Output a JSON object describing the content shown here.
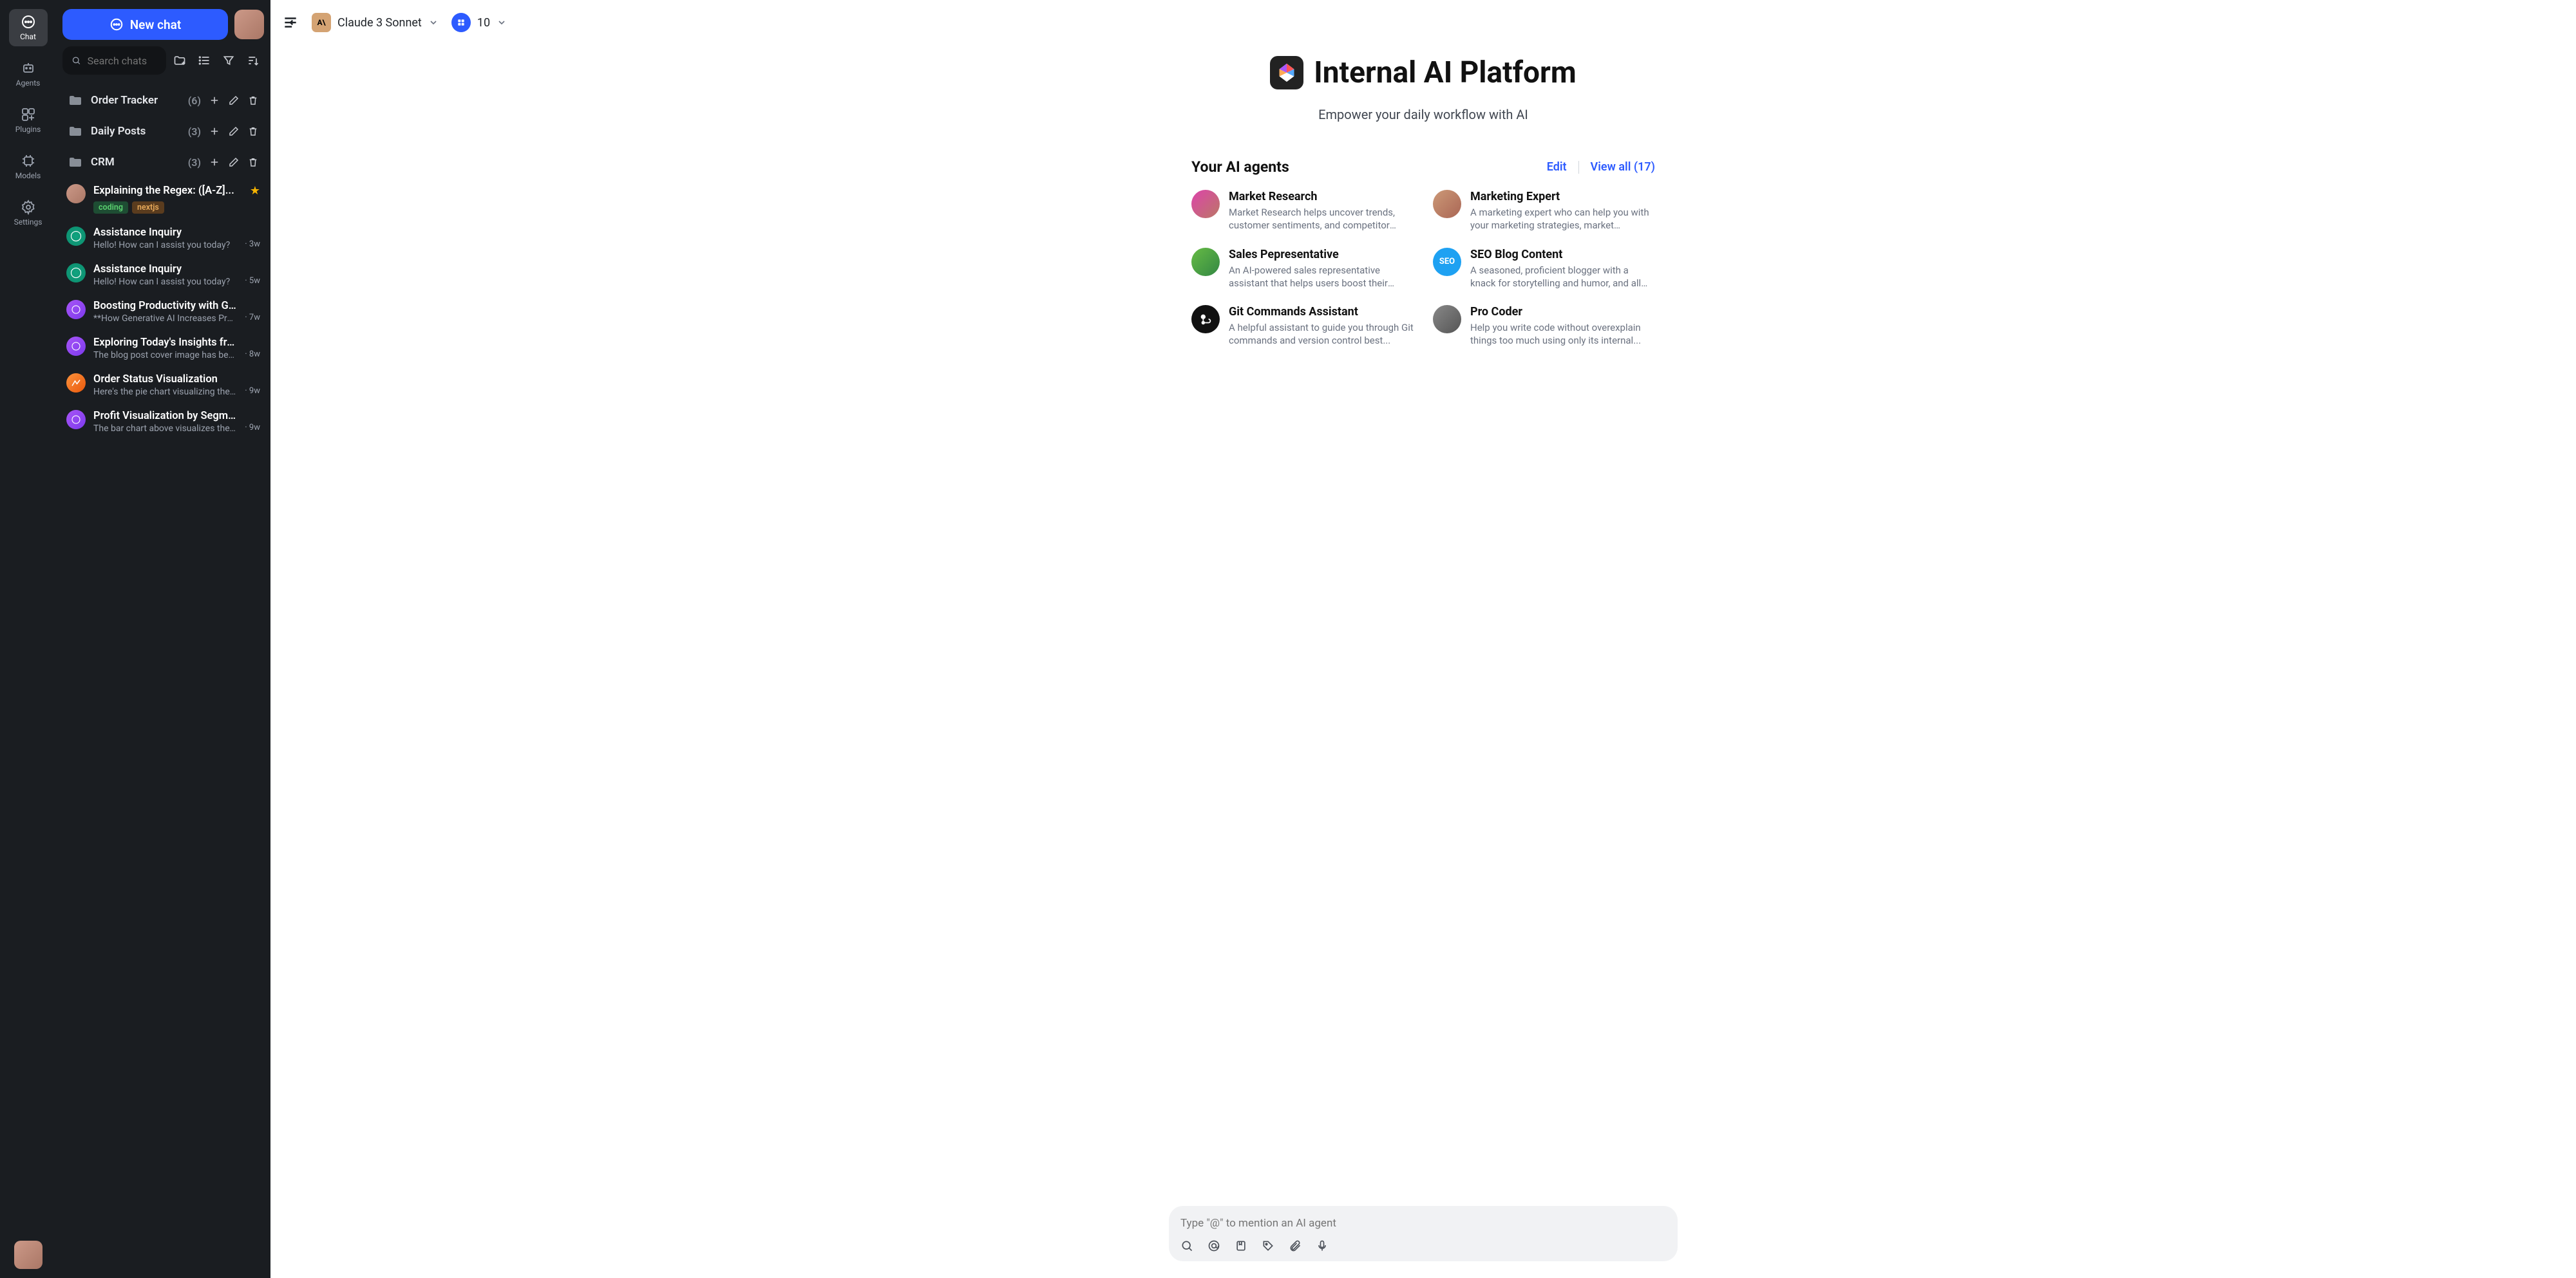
{
  "rail": {
    "items": [
      {
        "label": "Chat",
        "icon": "chat"
      },
      {
        "label": "Agents",
        "icon": "agents"
      },
      {
        "label": "Plugins",
        "icon": "plugins"
      },
      {
        "label": "Models",
        "icon": "models"
      },
      {
        "label": "Settings",
        "icon": "settings"
      }
    ]
  },
  "sidebar": {
    "new_chat_label": "New chat",
    "search_placeholder": "Search chats",
    "folders": [
      {
        "name": "Order Tracker",
        "count": "(6)"
      },
      {
        "name": "Daily Posts",
        "count": "(3)"
      },
      {
        "name": "CRM",
        "count": "(3)"
      }
    ],
    "chats": [
      {
        "title": "Explaining the Regex: ([A-Z]...",
        "preview": "",
        "time": "",
        "starred": true,
        "tags": [
          "coding",
          "nextjs"
        ],
        "avatar": "user"
      },
      {
        "title": "Assistance Inquiry",
        "preview": "Hello! How can I assist you today?",
        "time": "· 3w",
        "avatar": "gpt"
      },
      {
        "title": "Assistance Inquiry",
        "preview": "Hello! How can I assist you today?",
        "time": "· 5w",
        "avatar": "gpt"
      },
      {
        "title": "Boosting Productivity with Gen...",
        "preview": "**How Generative AI Increases Prod...",
        "time": "· 7w",
        "avatar": "purple"
      },
      {
        "title": "Exploring Today's Insights from...",
        "preview": "The blog post cover image has bee...",
        "time": "· 8w",
        "avatar": "purple"
      },
      {
        "title": "Order Status Visualization",
        "preview": "Here's the pie chart visualizing the ...",
        "time": "· 9w",
        "avatar": "orange"
      },
      {
        "title": "Profit Visualization by Segment...",
        "preview": "The bar chart above visualizes the ...",
        "time": "· 9w",
        "avatar": "purple"
      }
    ]
  },
  "topbar": {
    "model_label": "Claude 3 Sonnet",
    "plugin_count": "10"
  },
  "hero": {
    "title": "Internal AI Platform",
    "subtitle": "Empower your daily workflow with AI"
  },
  "agents": {
    "section_title": "Your AI agents",
    "edit_label": "Edit",
    "viewall_label": "View all (17)",
    "items": [
      {
        "name": "Market Research",
        "desc": "Market Research helps uncover trends, customer sentiments, and competitor mov..."
      },
      {
        "name": "Marketing Expert",
        "desc": "A marketing expert who can help you with your marketing strategies, market research..."
      },
      {
        "name": "Sales Pepresentative",
        "desc": "An AI-powered sales representative assistant that helps users boost their sales..."
      },
      {
        "name": "SEO Blog Content",
        "desc": "A seasoned, proficient blogger with a knack for storytelling and humor, and all other..."
      },
      {
        "name": "Git Commands Assistant",
        "desc": "A helpful assistant to guide you through Git commands and version control best..."
      },
      {
        "name": "Pro Coder",
        "desc": "Help you write code without overexplain things too much using only its internal..."
      }
    ]
  },
  "composer": {
    "placeholder": "Type \"@\" to mention an AI agent"
  }
}
